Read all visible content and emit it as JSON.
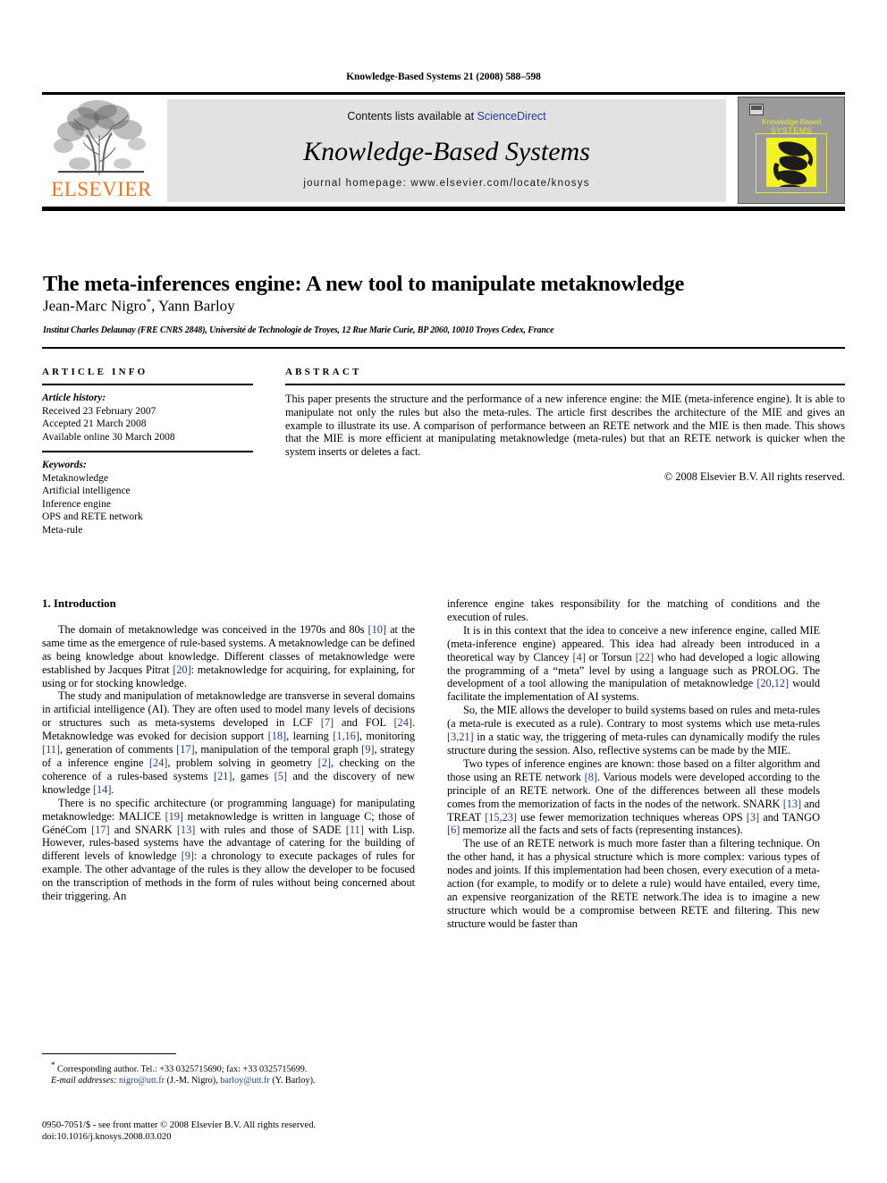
{
  "running_head": "Knowledge-Based Systems 21 (2008) 588–598",
  "masthead": {
    "publisher_name": "ELSEVIER",
    "contents_prefix": "Contents lists available at ",
    "contents_link": "ScienceDirect",
    "journal_title": "Knowledge-Based Systems",
    "homepage": "journal homepage: www.elsevier.com/locate/knosys",
    "cover": {
      "line1": "Knowledge-Based",
      "line2": "SYSTEMS"
    }
  },
  "title": "The meta-inferences engine: A new tool to manipulate metaknowledge",
  "authors": "Jean-Marc Nigro",
  "authors_star": "*",
  "authors_rest": ", Yann Barloy",
  "affiliation": "Institut Charles Delaunay (FRE CNRS 2848), Université de Technologie de Troyes, 12 Rue Marie Curie, BP 2060, 10010 Troyes Cedex, France",
  "article_info": {
    "heading": "ARTICLE INFO",
    "history_label": "Article history:",
    "history": [
      "Received 23 February 2007",
      "Accepted 21 March 2008",
      "Available online 30 March 2008"
    ],
    "keywords_label": "Keywords:",
    "keywords": [
      "Metaknowledge",
      "Artificial intelligence",
      "Inference engine",
      "OPS and RETE network",
      "Meta-rule"
    ]
  },
  "abstract": {
    "heading": "ABSTRACT",
    "text": "This paper presents the structure and the performance of a new inference engine: the MIE (meta-inference engine). It is able to manipulate not only the rules but also the meta-rules. The article first describes the architecture of the MIE and gives an example to illustrate its use. A comparison of performance between an RETE network and the MIE is then made. This shows that the MIE is more efficient at manipulating metaknowledge (meta-rules) but that an RETE network is quicker when the system inserts or deletes a fact.",
    "copyright": "© 2008 Elsevier B.V. All rights reserved."
  },
  "body": {
    "section_heading": "1. Introduction",
    "left_paragraphs": [
      {
        "segments": [
          {
            "t": "The domain of metaknowledge was conceived in the 1970s and 80s "
          },
          {
            "t": "[10]",
            "cite": true
          },
          {
            "t": " at the same time as the emergence of rule-based systems. A metaknowledge can be defined as being knowledge about knowledge. Different classes of metaknowledge were established by Jacques Pitrat "
          },
          {
            "t": "[20]",
            "cite": true
          },
          {
            "t": ": metaknowledge for acquiring, for explaining, for using or for stocking knowledge."
          }
        ]
      },
      {
        "segments": [
          {
            "t": "The study and manipulation of metaknowledge are transverse in several domains in artificial intelligence (AI). They are often used to model many levels of decisions or structures such as meta-systems developed in LCF "
          },
          {
            "t": "[7]",
            "cite": true
          },
          {
            "t": " and FOL "
          },
          {
            "t": "[24]",
            "cite": true
          },
          {
            "t": ". Metaknowledge was evoked for decision support "
          },
          {
            "t": "[18]",
            "cite": true
          },
          {
            "t": ", learning "
          },
          {
            "t": "[1,16]",
            "cite": true
          },
          {
            "t": ", monitoring "
          },
          {
            "t": "[11]",
            "cite": true
          },
          {
            "t": ", generation of comments "
          },
          {
            "t": "[17]",
            "cite": true
          },
          {
            "t": ", manipulation of the temporal graph "
          },
          {
            "t": "[9]",
            "cite": true
          },
          {
            "t": ", strategy of a inference engine "
          },
          {
            "t": "[24]",
            "cite": true
          },
          {
            "t": ", problem solving in geometry "
          },
          {
            "t": "[2]",
            "cite": true
          },
          {
            "t": ", checking on the coherence of a rules-based systems "
          },
          {
            "t": "[21]",
            "cite": true
          },
          {
            "t": ", games "
          },
          {
            "t": "[5]",
            "cite": true
          },
          {
            "t": " and the discovery of new knowledge "
          },
          {
            "t": "[14]",
            "cite": true
          },
          {
            "t": "."
          }
        ]
      },
      {
        "segments": [
          {
            "t": "There is no specific architecture (or programming language) for manipulating metaknowledge: MALICE "
          },
          {
            "t": "[19]",
            "cite": true
          },
          {
            "t": " metaknowledge is written in language C; those of GénéCom "
          },
          {
            "t": "[17]",
            "cite": true
          },
          {
            "t": " and SNARK "
          },
          {
            "t": "[13]",
            "cite": true
          },
          {
            "t": " with rules and those of SADE "
          },
          {
            "t": "[11]",
            "cite": true
          },
          {
            "t": " with Lisp. However, rules-based systems have the advantage of catering for the building of different levels of knowledge "
          },
          {
            "t": "[9]",
            "cite": true
          },
          {
            "t": ": a chronology to execute packages of rules for example. The other advantage of the rules is they allow the developer to be focused on the transcription of methods in the form of rules without being concerned about their triggering. An"
          }
        ]
      }
    ],
    "right_paragraphs": [
      {
        "continued": true,
        "segments": [
          {
            "t": "inference engine takes responsibility for the matching of conditions and the execution of rules."
          }
        ]
      },
      {
        "segments": [
          {
            "t": "It is in this context that the idea to conceive a new inference engine, called MIE (meta-inference engine) appeared. This idea had already been introduced in a theoretical way by Clancey "
          },
          {
            "t": "[4]",
            "cite": true
          },
          {
            "t": " or Torsun "
          },
          {
            "t": "[22]",
            "cite": true
          },
          {
            "t": " who had developed a logic allowing the programming of a “meta” level by using a language such as PROLOG. The development of a tool allowing the manipulation of metaknowledge "
          },
          {
            "t": "[20,12]",
            "cite": true
          },
          {
            "t": " would facilitate the implementation of AI systems."
          }
        ]
      },
      {
        "segments": [
          {
            "t": "So, the MIE allows the developer to build systems based on rules and meta-rules (a meta-rule is executed as a rule). Contrary to most systems which use meta-rules "
          },
          {
            "t": "[3,21]",
            "cite": true
          },
          {
            "t": " in a static way, the triggering of meta-rules can dynamically modify the rules structure during the session. Also, reflective systems can be made by the MIE."
          }
        ]
      },
      {
        "segments": [
          {
            "t": "Two types of inference engines are known: those based on a filter algorithm and those using an RETE network "
          },
          {
            "t": "[8]",
            "cite": true
          },
          {
            "t": ". Various models were developed according to the principle of an RETE network. One of the differences between all these models comes from the memorization of facts in the nodes of the network. SNARK "
          },
          {
            "t": "[13]",
            "cite": true
          },
          {
            "t": " and TREAT "
          },
          {
            "t": "[15,23]",
            "cite": true
          },
          {
            "t": " use fewer memorization techniques whereas OPS "
          },
          {
            "t": "[3]",
            "cite": true
          },
          {
            "t": " and TANGO "
          },
          {
            "t": "[6]",
            "cite": true
          },
          {
            "t": " memorize all the facts and sets of facts (representing instances)."
          }
        ]
      },
      {
        "segments": [
          {
            "t": "The use of an RETE network is much more faster than a filtering technique. On the other hand, it has a physical structure which is more complex: various types of nodes and joints. If this implementation had been chosen, every execution of a meta-action (for example, to modify or to delete a rule) would have entailed, every time, an expensive reorganization of the RETE network.The idea is to imagine a new structure which would be a compromise between RETE and filtering. This new structure would be faster than"
          }
        ]
      }
    ]
  },
  "footnote": {
    "star": "*",
    "corresponding": " Corresponding author. Tel.: +33 0325715690; fax: +33 0325715699.",
    "email_label": "E-mail addresses:",
    "email1": "nigro@utt.fr",
    "email1_name": " (J.-M. Nigro), ",
    "email2": "barloy@utt.fr",
    "email2_name": " (Y. Barloy)."
  },
  "colophon": {
    "line1": "0950-7051/$ - see front matter © 2008 Elsevier B.V. All rights reserved.",
    "line2": "doi:10.1016/j.knosys.2008.03.020"
  }
}
